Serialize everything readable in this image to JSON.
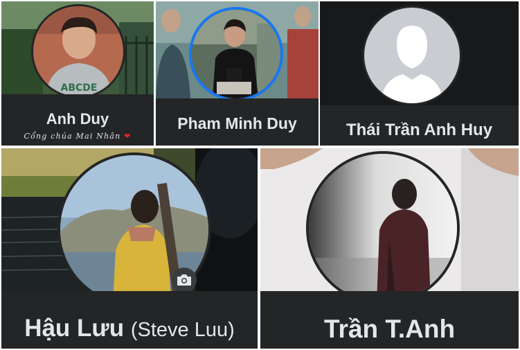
{
  "profiles": [
    {
      "name": "Anh Duy",
      "bio": "Cổng chúa Mai Nhân",
      "bio_emoji": "❤"
    },
    {
      "name": "Pham Minh Duy"
    },
    {
      "name": "Thái Trần Anh Huy"
    },
    {
      "name": "Hậu Lưu",
      "alt_name": "(Steve Luu)",
      "camera_icon": "camera-icon"
    },
    {
      "name": "Trần T.Anh"
    }
  ],
  "colors": {
    "card_background": "#242526",
    "text": "#e4e6eb",
    "story_ring": "#1877f2",
    "heart": "#e02424"
  }
}
